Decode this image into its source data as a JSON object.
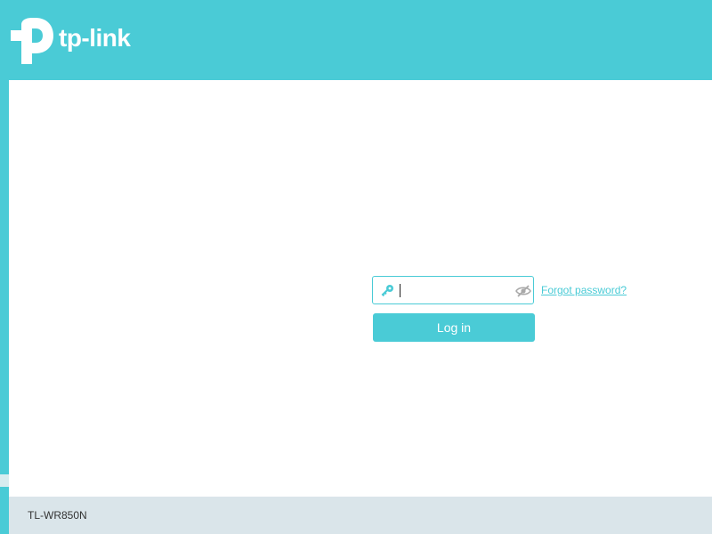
{
  "brand": {
    "logo_text": "tp-link",
    "accent_color": "#4acbd6"
  },
  "login": {
    "password_value": "",
    "key_icon": "key-icon",
    "visibility_icon": "eye-slash-icon",
    "forgot_password_label": "Forgot password?",
    "login_button_label": "Log in"
  },
  "footer": {
    "model": "TL-WR850N",
    "background_color": "#dae5ea"
  }
}
